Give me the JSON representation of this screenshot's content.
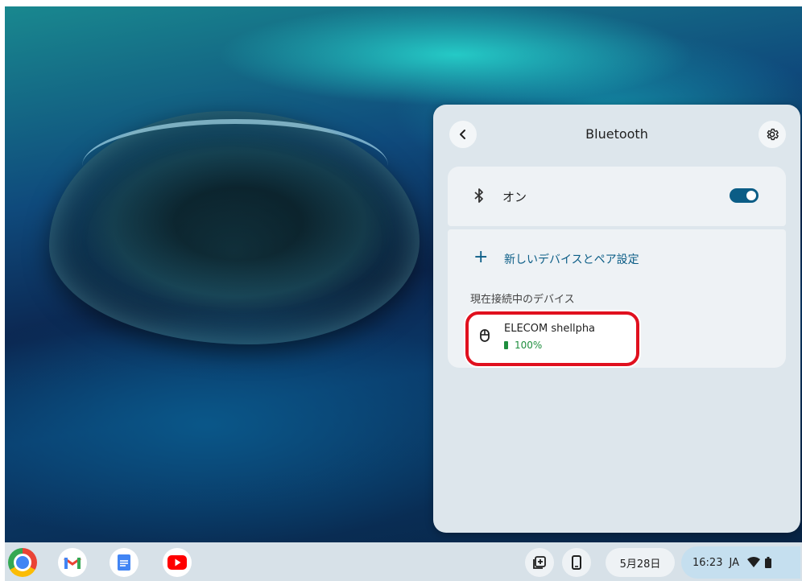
{
  "panel": {
    "title": "Bluetooth",
    "toggle_label": "オン",
    "toggle_state": true,
    "pair_label": "新しいデバイスとペア設定",
    "connected_heading": "現在接続中のデバイス",
    "devices": [
      {
        "name": "ELECOM shellpha",
        "battery": "100%"
      }
    ]
  },
  "shelf": {
    "apps": [
      "Chrome",
      "Gmail",
      "Docs",
      "YouTube"
    ],
    "date": "5月28日",
    "time": "16:23",
    "ime": "JA"
  },
  "colors": {
    "accent": "#0b5d86",
    "battery_green": "#1e8e3e",
    "highlight_red": "#e0101e",
    "panel_bg": "#dde6ec"
  },
  "icons": {
    "back": "chevron-left-icon",
    "settings": "gear-icon",
    "bluetooth": "bluetooth-icon",
    "add": "plus-icon",
    "device": "mouse-icon",
    "battery": "battery-icon",
    "wifi": "wifi-icon"
  }
}
